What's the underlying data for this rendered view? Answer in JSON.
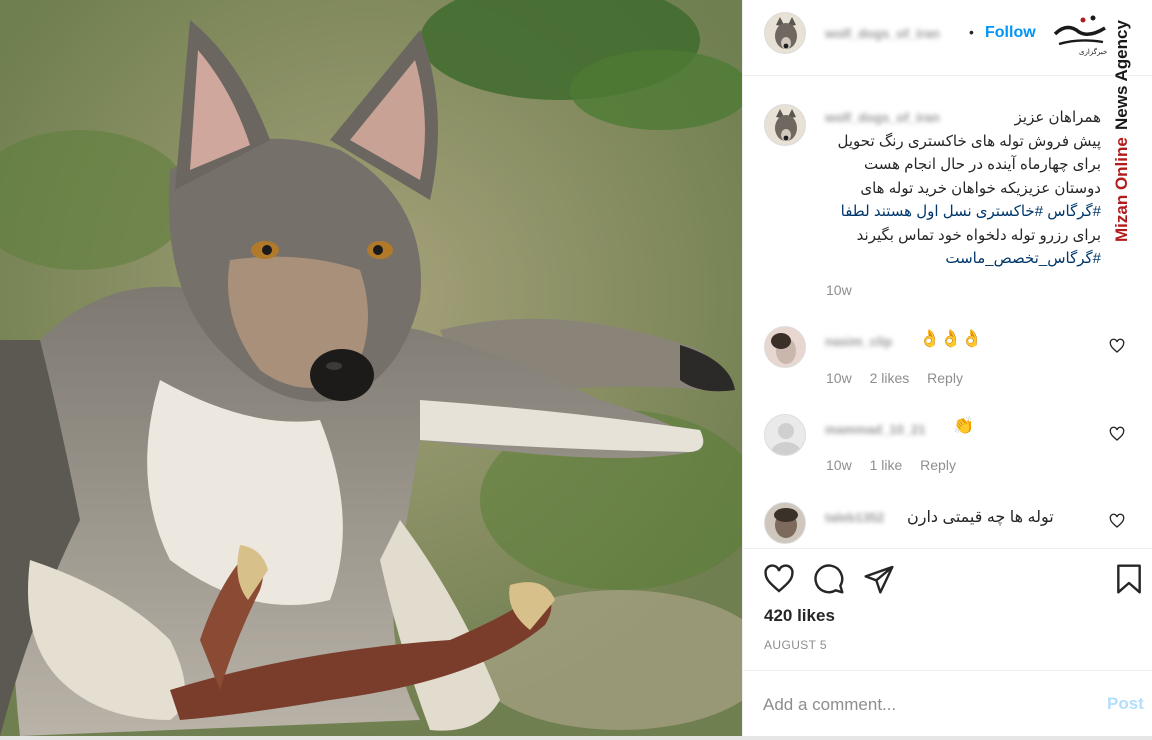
{
  "post": {
    "username": "wolf_dogs_of_iran",
    "follow_label": "Follow",
    "separator": "•",
    "caption_lines": [
      "همراهان عزیز",
      "پیش فروش توله های خاکستری رنگ تحویل",
      "برای چهارماه آینده در حال انجام هست",
      "دوستان عزیزیکه خواهان خرید توله های",
      "#گرگاس #خاکستری نسل اول هستند لطفا",
      "برای رزرو توله دلخواه خود تماس بگیرند",
      "#گرگاس_تخصص_ماست"
    ],
    "caption_time": "10w",
    "likes": "420 likes",
    "date": "AUGUST 5"
  },
  "comments": [
    {
      "username": "nasim_clip",
      "text": "👌👌👌",
      "time": "10w",
      "likes": "2 likes",
      "reply": "Reply"
    },
    {
      "username": "mammad_10_21",
      "text": "👏",
      "time": "10w",
      "likes": "1 like",
      "reply": "Reply"
    },
    {
      "username": "taleb1352",
      "text": "توله ها چه قیمتی دارن"
    }
  ],
  "add_comment": {
    "placeholder": "Add a comment...",
    "post_label": "Post"
  },
  "watermark": {
    "vertical_red": "Mizan Online",
    "vertical_black": "News Agency",
    "logo_caption": "خبرگزاری"
  },
  "icons": [
    "heart-icon",
    "comment-icon",
    "share-icon",
    "bookmark-icon",
    "heart-small-icon"
  ],
  "colors": {
    "link_blue": "#0095f6",
    "post_disabled": "#b2dffc",
    "watermark_red": "#b01c1c",
    "hashtag": "#00376b"
  }
}
